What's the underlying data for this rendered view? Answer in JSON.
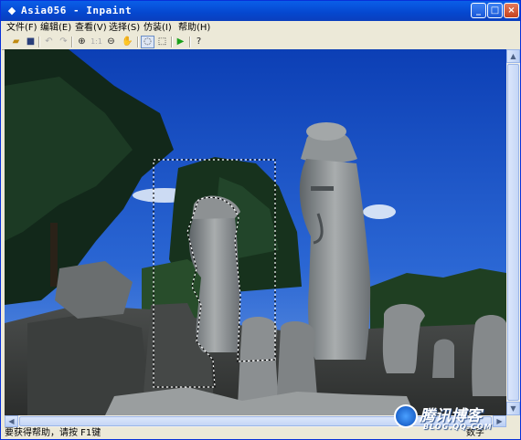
{
  "window": {
    "title": "Asia056 - Inpaint"
  },
  "menu": [
    {
      "label": "文件(F)"
    },
    {
      "label": "编辑(E)"
    },
    {
      "label": "查看(V)"
    },
    {
      "label": "选择(S)"
    },
    {
      "label": "仿装(I)"
    },
    {
      "label": "帮助(H)"
    }
  ],
  "toolbar_icons": [
    "open-icon",
    "save-icon",
    "undo-icon",
    "redo-icon",
    "zoom-in-icon",
    "actual-size-icon",
    "zoom-out-icon",
    "pan-hand-icon",
    "lasso-icon",
    "rect-select-icon",
    "run-icon",
    "help-icon"
  ],
  "status": {
    "text": "要获得帮助，请按 F1键",
    "right": "数字"
  },
  "watermark": {
    "name": "腾讯博客",
    "url": "BLOG.QQ.COM"
  },
  "colors": {
    "titlebar": "#0a5fe8",
    "sky": "#1a50c0",
    "selection_outline": "#ffffff"
  }
}
